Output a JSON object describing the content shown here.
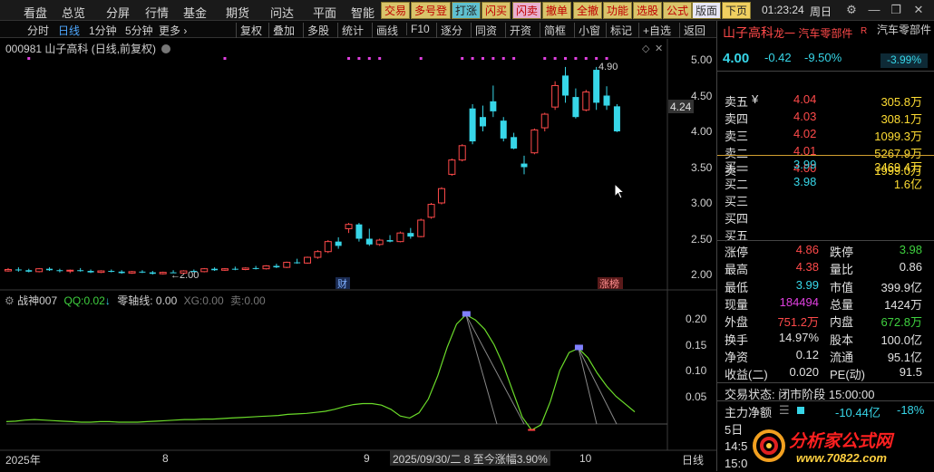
{
  "menubar": {
    "items": [
      "看盘",
      "总览",
      "分屏",
      "行情",
      "基金",
      "期货",
      "问达",
      "平面",
      "智能"
    ],
    "yellow_buttons": [
      "交易",
      "多号登",
      "打涨",
      "闪买",
      "闪卖",
      "撤单",
      "全撤",
      "功能",
      "选股",
      "公式",
      "版面",
      "下页"
    ],
    "time": "01:23:24",
    "weekday": "周日"
  },
  "toolbar": {
    "periods": [
      "分时",
      "日线",
      "1分钟",
      "5分钟",
      "更多 ›"
    ],
    "actions": [
      "复权",
      "叠加",
      "多股",
      "统计",
      "画线",
      "F10",
      "逐分",
      "同资",
      "开资",
      "简框",
      "小窗",
      "标记",
      "+自选",
      "返回"
    ]
  },
  "chart": {
    "title": "000981 山子高科 (日线,前复权)",
    "y_ticks": [
      "5.00",
      "4.50",
      "4.00",
      "3.50",
      "3.00",
      "2.50",
      "2.00"
    ],
    "last_price_label": "4.24",
    "high_annotation": "4.90",
    "low_annotation": "2.00",
    "markers": [
      "财",
      "涨榜"
    ],
    "candles": [
      [
        2.05,
        2.09,
        2.04,
        2.07
      ],
      [
        2.07,
        2.1,
        2.04,
        2.06
      ],
      [
        2.06,
        2.08,
        2.03,
        2.04
      ],
      [
        2.04,
        2.09,
        2.03,
        2.08
      ],
      [
        2.08,
        2.1,
        2.05,
        2.06
      ],
      [
        2.06,
        2.08,
        2.03,
        2.05
      ],
      [
        2.05,
        2.07,
        2.02,
        2.06
      ],
      [
        2.06,
        2.09,
        2.04,
        2.05
      ],
      [
        2.05,
        2.07,
        2.02,
        2.03
      ],
      [
        2.03,
        2.06,
        2.02,
        2.05
      ],
      [
        2.05,
        2.07,
        2.03,
        2.04
      ],
      [
        2.04,
        2.06,
        2.01,
        2.02
      ],
      [
        2.02,
        2.05,
        2.01,
        2.04
      ],
      [
        2.04,
        2.06,
        2.02,
        2.03
      ],
      [
        2.03,
        2.05,
        2.0,
        2.01
      ],
      [
        2.01,
        2.04,
        2.0,
        2.03
      ],
      [
        2.03,
        2.06,
        2.02,
        2.02
      ],
      [
        2.02,
        2.06,
        2.01,
        2.05
      ],
      [
        2.05,
        2.07,
        2.03,
        2.04
      ],
      [
        2.04,
        2.09,
        2.03,
        2.08
      ],
      [
        2.08,
        2.1,
        2.05,
        2.06
      ],
      [
        2.06,
        2.09,
        2.05,
        2.08
      ],
      [
        2.08,
        2.11,
        2.06,
        2.07
      ],
      [
        2.07,
        2.1,
        2.06,
        2.09
      ],
      [
        2.09,
        2.12,
        2.07,
        2.08
      ],
      [
        2.08,
        2.13,
        2.07,
        2.12
      ],
      [
        2.12,
        2.15,
        2.09,
        2.1
      ],
      [
        2.1,
        2.18,
        2.09,
        2.17
      ],
      [
        2.17,
        2.22,
        2.15,
        2.16
      ],
      [
        2.16,
        2.25,
        2.15,
        2.24
      ],
      [
        2.24,
        2.34,
        2.22,
        2.32
      ],
      [
        2.32,
        2.48,
        2.3,
        2.46
      ],
      [
        2.46,
        2.52,
        2.36,
        2.4
      ],
      [
        2.64,
        2.72,
        2.58,
        2.7
      ],
      [
        2.7,
        2.72,
        2.46,
        2.5
      ],
      [
        2.5,
        2.64,
        2.4,
        2.42
      ],
      [
        2.42,
        2.5,
        2.4,
        2.48
      ],
      [
        2.48,
        2.55,
        2.45,
        2.46
      ],
      [
        2.46,
        2.6,
        2.45,
        2.58
      ],
      [
        2.58,
        2.65,
        2.5,
        2.53
      ],
      [
        2.53,
        2.78,
        2.52,
        2.76
      ],
      [
        2.8,
        3.0,
        2.78,
        2.98
      ],
      [
        3.0,
        3.22,
        2.98,
        3.2
      ],
      [
        3.4,
        3.62,
        3.38,
        3.6
      ],
      [
        3.6,
        3.82,
        3.58,
        3.8
      ],
      [
        4.32,
        4.38,
        3.82,
        3.86
      ],
      [
        4.2,
        4.36,
        4.0,
        4.07
      ],
      [
        4.42,
        4.64,
        4.2,
        4.28
      ],
      [
        4.15,
        4.2,
        3.86,
        3.9
      ],
      [
        3.92,
        3.98,
        3.75,
        3.76
      ],
      [
        3.55,
        3.66,
        3.4,
        3.5
      ],
      [
        3.7,
        4.04,
        3.68,
        4.02
      ],
      [
        4.05,
        4.26,
        4.0,
        4.24
      ],
      [
        4.34,
        4.7,
        4.3,
        4.64
      ],
      [
        4.78,
        4.9,
        4.4,
        4.5
      ],
      [
        4.48,
        4.6,
        4.18,
        4.2
      ],
      [
        4.3,
        4.58,
        4.28,
        4.55
      ],
      [
        4.86,
        4.9,
        4.3,
        4.4
      ],
      [
        4.5,
        4.63,
        4.3,
        4.36
      ],
      [
        4.35,
        4.38,
        3.99,
        4.0
      ]
    ],
    "dot_rows": [
      2,
      3,
      4,
      5,
      6,
      7,
      8,
      9,
      10,
      11,
      12,
      13,
      14,
      15,
      16,
      17,
      18,
      19,
      20,
      21,
      22,
      23,
      24,
      25,
      26,
      27,
      28,
      29,
      30,
      31,
      32,
      33,
      34,
      35,
      36,
      37,
      38,
      39,
      40,
      41,
      42,
      43,
      44,
      45,
      46,
      47,
      48,
      49,
      50,
      51,
      52,
      53,
      54,
      55,
      56,
      57,
      58,
      59,
      60
    ]
  },
  "indicator": {
    "name": "战神007",
    "qq_label": "QQ:",
    "qq_value": "0.02",
    "zero_label": "零轴线:",
    "zero_value": "0.00",
    "xg_label": "XG:",
    "xg_value": "0.00",
    "mai_label": "卖:",
    "mai_value": "0.00",
    "y_ticks": [
      "0.20",
      "0.15",
      "0.10",
      "0.05"
    ],
    "line": [
      0.001,
      0.002,
      0.004,
      0.005,
      0.004,
      0.003,
      0.002,
      0.001,
      0.0,
      0.0,
      0.001,
      0.001,
      0.0,
      0.0,
      0.0,
      0.001,
      0.002,
      0.003,
      0.004,
      0.005,
      0.005,
      0.006,
      0.006,
      0.007,
      0.008,
      0.009,
      0.01,
      0.011,
      0.012,
      0.013,
      0.015,
      0.016,
      0.017,
      0.019,
      0.021,
      0.025,
      0.03,
      0.034,
      0.036,
      0.036,
      0.033,
      0.025,
      0.012,
      0.008,
      0.018,
      0.045,
      0.09,
      0.145,
      0.19,
      0.208,
      0.198,
      0.18,
      0.15,
      0.11,
      0.06,
      0.01,
      -0.015,
      -0.005,
      0.04,
      0.1,
      0.135,
      0.143,
      0.125,
      0.095,
      0.07,
      0.05,
      0.035,
      0.02
    ],
    "sell_markers": [
      50,
      61
    ]
  },
  "xaxis": {
    "labels": [
      "2025年",
      "8",
      "9",
      "10"
    ],
    "status": "2025/09/30/二 8 至今涨幅3.90%",
    "period": "日线"
  },
  "quote": {
    "name": "山子高科",
    "badge1": "龙一 汽车零部件",
    "badge_r": "R",
    "sector": "汽车零部件",
    "price": "4.00",
    "change": "-0.42",
    "pct": "-9.50%",
    "sector_pct": "-3.99%",
    "asks": [
      [
        "卖五",
        "¥",
        "4.04",
        "305.8万"
      ],
      [
        "卖四",
        "",
        "4.03",
        "308.1万"
      ],
      [
        "卖三",
        "",
        "4.02",
        "1099.3万"
      ],
      [
        "卖二",
        "",
        "4.01",
        "5267.9万"
      ],
      [
        "卖一",
        "",
        "4.00",
        "1999.0万"
      ]
    ],
    "bids": [
      [
        "买一",
        "3.99",
        "3469.4万"
      ],
      [
        "买二",
        "3.98",
        "1.6亿"
      ],
      [
        "买三",
        "",
        ""
      ],
      [
        "买四",
        "",
        ""
      ],
      [
        "买五",
        "",
        ""
      ]
    ],
    "stats": [
      [
        "涨停",
        "4.86",
        "跌停",
        "3.98"
      ],
      [
        "最高",
        "4.38",
        "量比",
        "0.86"
      ],
      [
        "最低",
        "3.99",
        "市值",
        "399.9亿"
      ],
      [
        "现量",
        "184494",
        "总量",
        "1424万"
      ],
      [
        "外盘",
        "751.2万",
        "内盘",
        "672.8万"
      ],
      [
        "换手",
        "14.97%",
        "股本",
        "100.0亿"
      ],
      [
        "净资",
        "0.12",
        "流通",
        "95.1亿"
      ],
      [
        "收益(二)",
        "0.020",
        "PE(动)",
        "91.5"
      ]
    ],
    "trade_status": "交易状态: 闭市阶段 15:00:00",
    "net_flow_label": "主力净额",
    "net_flow": "-10.44亿",
    "net_flow_pct": "-18%",
    "days_label": "5日",
    "time_cut": "14:5",
    "time_cut2": "15:0",
    "logo": "分析家公式网",
    "logo_url": "www.70822.com",
    "colors": {
      "up": "#ff4a4a",
      "down": "#37d6e8",
      "line": "#6bdc2a"
    }
  }
}
